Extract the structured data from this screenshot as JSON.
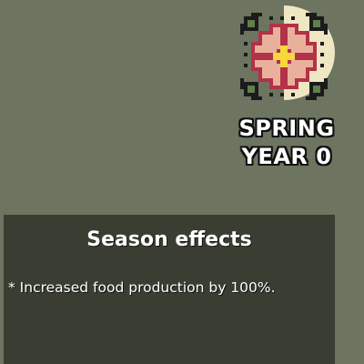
{
  "season": {
    "name": "SPRING",
    "year_label": "YEAR 0",
    "icon": "flower-icon",
    "phase_disc": "moon-phase-disc"
  },
  "effects_panel": {
    "title": "Season effects",
    "items": [
      "* Increased food production by 100%."
    ]
  },
  "colors": {
    "background": "#6d7460",
    "panel": "#3a3e32",
    "disc": "#efe6c3",
    "petal": "#e9b19c",
    "petal_outline": "#b23248",
    "center": "#f6d83a",
    "leaf": "#5f7f4e",
    "text": "#ffffff"
  }
}
